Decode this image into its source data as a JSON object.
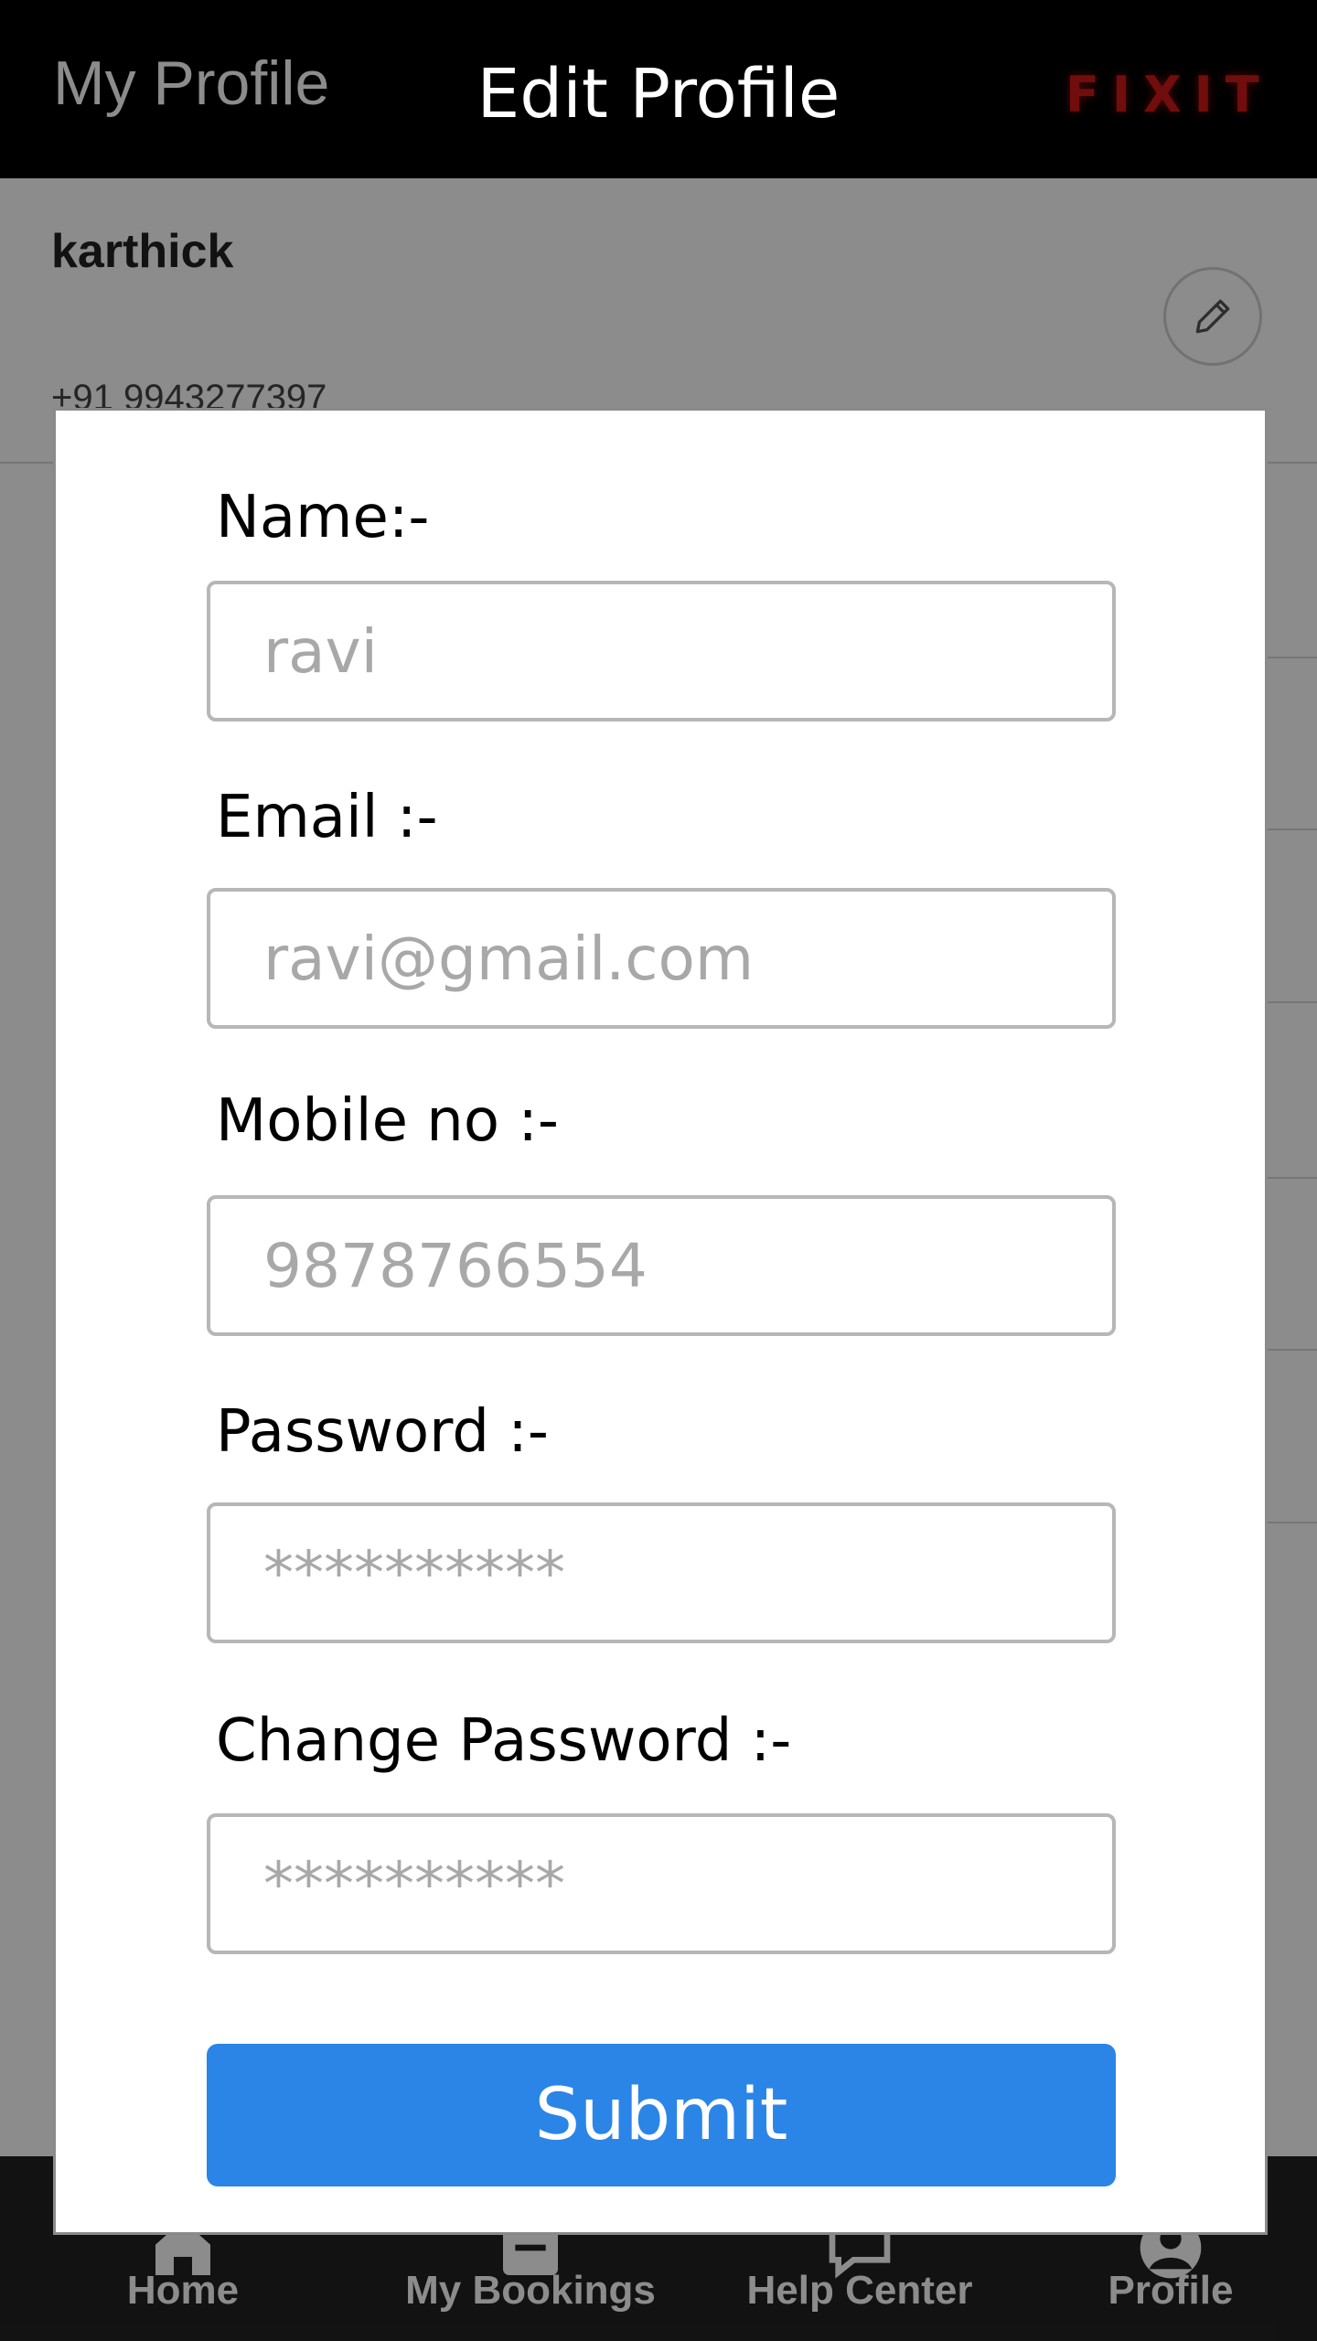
{
  "appbar": {
    "title": "My Profile",
    "brand": "FIXIT",
    "brand_color": "#d01818"
  },
  "profile": {
    "name": "karthick",
    "phone": "+91 9943277397",
    "edit_icon": "pencil-icon"
  },
  "bottom_nav": {
    "items": [
      {
        "label": "Home",
        "icon": "home-icon"
      },
      {
        "label": "My Bookings",
        "icon": "bookings-icon"
      },
      {
        "label": "Help Center",
        "icon": "chat-icon"
      },
      {
        "label": "Profile",
        "icon": "user-icon"
      }
    ]
  },
  "dialog": {
    "title": "Edit Profile",
    "fields": [
      {
        "label": "Name:-",
        "placeholder": "ravi"
      },
      {
        "label": "Email :-",
        "placeholder": "ravi@gmail.com"
      },
      {
        "label": "Mobile no :-",
        "placeholder": "9878766554"
      },
      {
        "label": "Password :-",
        "placeholder": "**********"
      },
      {
        "label": "Change Password :-",
        "placeholder": "**********"
      }
    ],
    "submit_label": "Submit",
    "submit_color": "#2b85e7"
  }
}
